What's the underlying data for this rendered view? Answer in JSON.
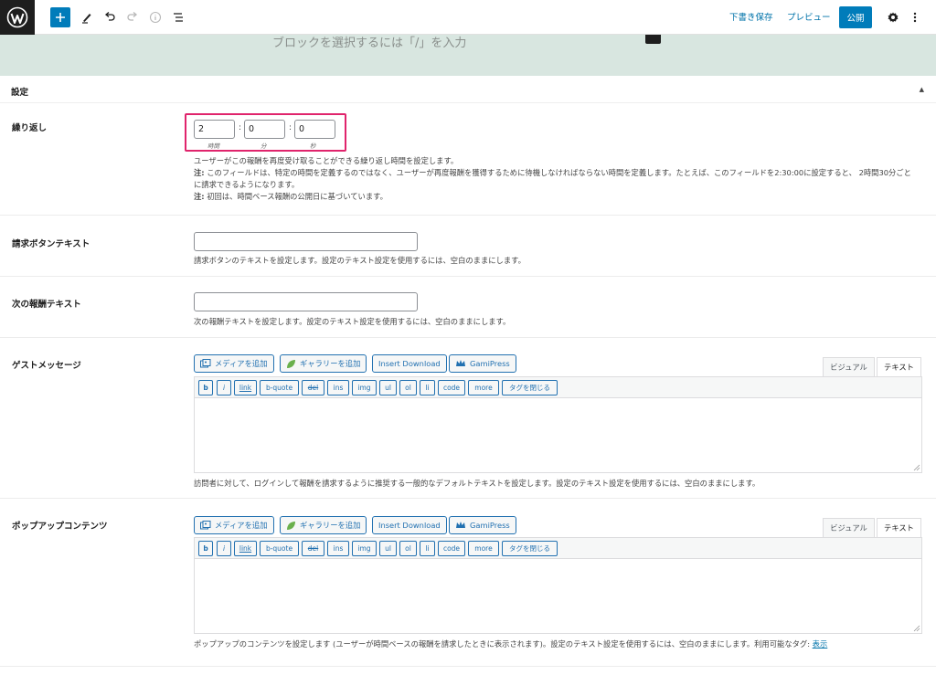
{
  "toolbar": {
    "save_draft": "下書き保存",
    "preview": "プレビュー",
    "publish": "公開"
  },
  "block": {
    "placeholder": "ブロックを選択するには「/」を入力"
  },
  "panel": {
    "title": "設定"
  },
  "repeat": {
    "label": "繰り返し",
    "hours": "2",
    "minutes": "0",
    "seconds": "0",
    "hours_unit": "時間",
    "minutes_unit": "分",
    "seconds_unit": "秒",
    "desc_line1": "ユーザーがこの報酬を再度受け取ることができる繰り返し時間を設定します。",
    "note_label": "注:",
    "desc_line2": " このフィールドは、特定の時間を定義するのではなく、ユーザーが再度報酬を獲得するために待機しなければならない時間を定義します。たとえば、このフィールドを2:30:00に設定すると、 2時間30分ごとに請求できるようになります。",
    "note2_label": "注:",
    "desc_line3": " 初回は、時間ベース報酬の公開日に基づいています。"
  },
  "claim_button": {
    "label": "請求ボタンテキスト",
    "value": "",
    "desc": "請求ボタンのテキストを設定します。設定のテキスト設定を使用するには、空白のままにします。"
  },
  "next_reward": {
    "label": "次の報酬テキスト",
    "value": "",
    "desc": "次の報酬テキストを設定します。設定のテキスト設定を使用するには、空白のままにします。"
  },
  "media_buttons": {
    "add_media": "メディアを追加",
    "gallery": "ギャラリーを追加",
    "insert_download": "Insert Download",
    "gamipress": "GamiPress"
  },
  "editor_tabs": {
    "visual": "ビジュアル",
    "text": "テキスト"
  },
  "quicktags": [
    "b",
    "i",
    "link",
    "b-quote",
    "del",
    "ins",
    "img",
    "ul",
    "ol",
    "li",
    "code",
    "more",
    "タグを閉じる"
  ],
  "guest_message": {
    "label": "ゲストメッセージ",
    "desc": "訪問者に対して、ログインして報酬を請求するように推奨する一般的なデフォルトテキストを設定します。設定のテキスト設定を使用するには、空白のままにします。"
  },
  "popup_content": {
    "label": "ポップアップコンテンツ",
    "desc": "ポップアップのコンテンツを設定します (ユーザーが時間ベースの報酬を請求したときに表示されます)。設定のテキスト設定を使用するには、空白のままにします。利用可能なタグ: ",
    "tags_link": "表示"
  },
  "colors": {
    "accent": "#007cba",
    "highlight": "#e0246c",
    "block_bg": "#d8e6e0"
  }
}
